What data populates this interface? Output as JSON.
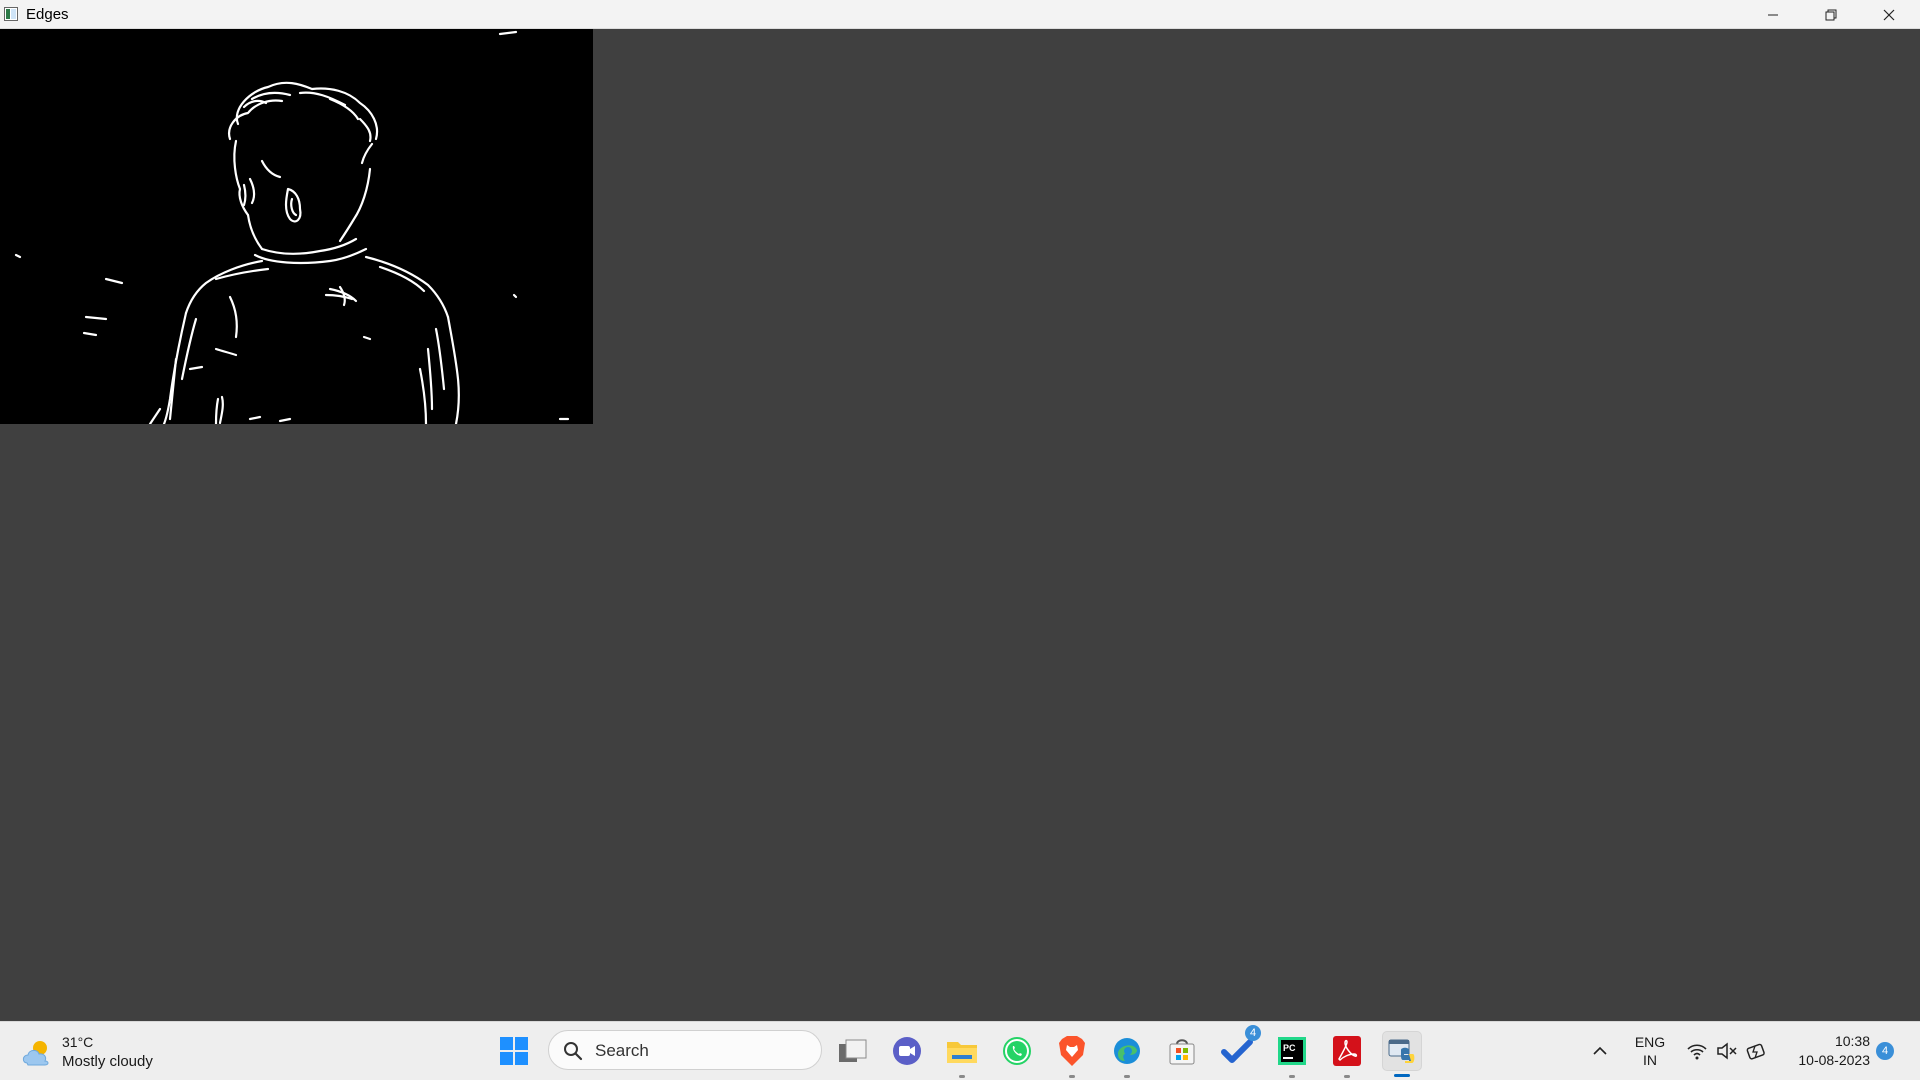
{
  "window": {
    "title": "Edges",
    "controls": [
      "minimize-icon",
      "restore-icon",
      "close-icon"
    ]
  },
  "taskbar": {
    "weather": {
      "temperature": "31°C",
      "condition": "Mostly cloudy",
      "icon": "partly-cloudy-icon"
    },
    "search": {
      "label": "Search"
    },
    "pinned_apps": [
      {
        "name": "task-view",
        "icon": "task-view-icon"
      },
      {
        "name": "meet-now",
        "icon": "video-camera-icon"
      },
      {
        "name": "file-explorer",
        "icon": "folder-icon"
      },
      {
        "name": "whatsapp",
        "icon": "whatsapp-icon"
      },
      {
        "name": "brave",
        "icon": "brave-lion-icon"
      },
      {
        "name": "edge",
        "icon": "edge-icon"
      },
      {
        "name": "microsoft-store",
        "icon": "store-icon"
      },
      {
        "name": "todo",
        "icon": "check-icon",
        "badge": "4"
      },
      {
        "name": "pycharm",
        "icon": "pycharm-icon"
      },
      {
        "name": "acrobat",
        "icon": "pdf-icon"
      },
      {
        "name": "python",
        "icon": "python-icon"
      }
    ],
    "tray": {
      "language_line1": "ENG",
      "language_line2": "IN",
      "time": "10:38",
      "date": "10-08-2023",
      "notification_count": "4"
    }
  },
  "colors": {
    "window_background": "#404040",
    "image_background": "#000000",
    "taskbar_background": "#eeeeee",
    "accent": "#0067c0"
  }
}
